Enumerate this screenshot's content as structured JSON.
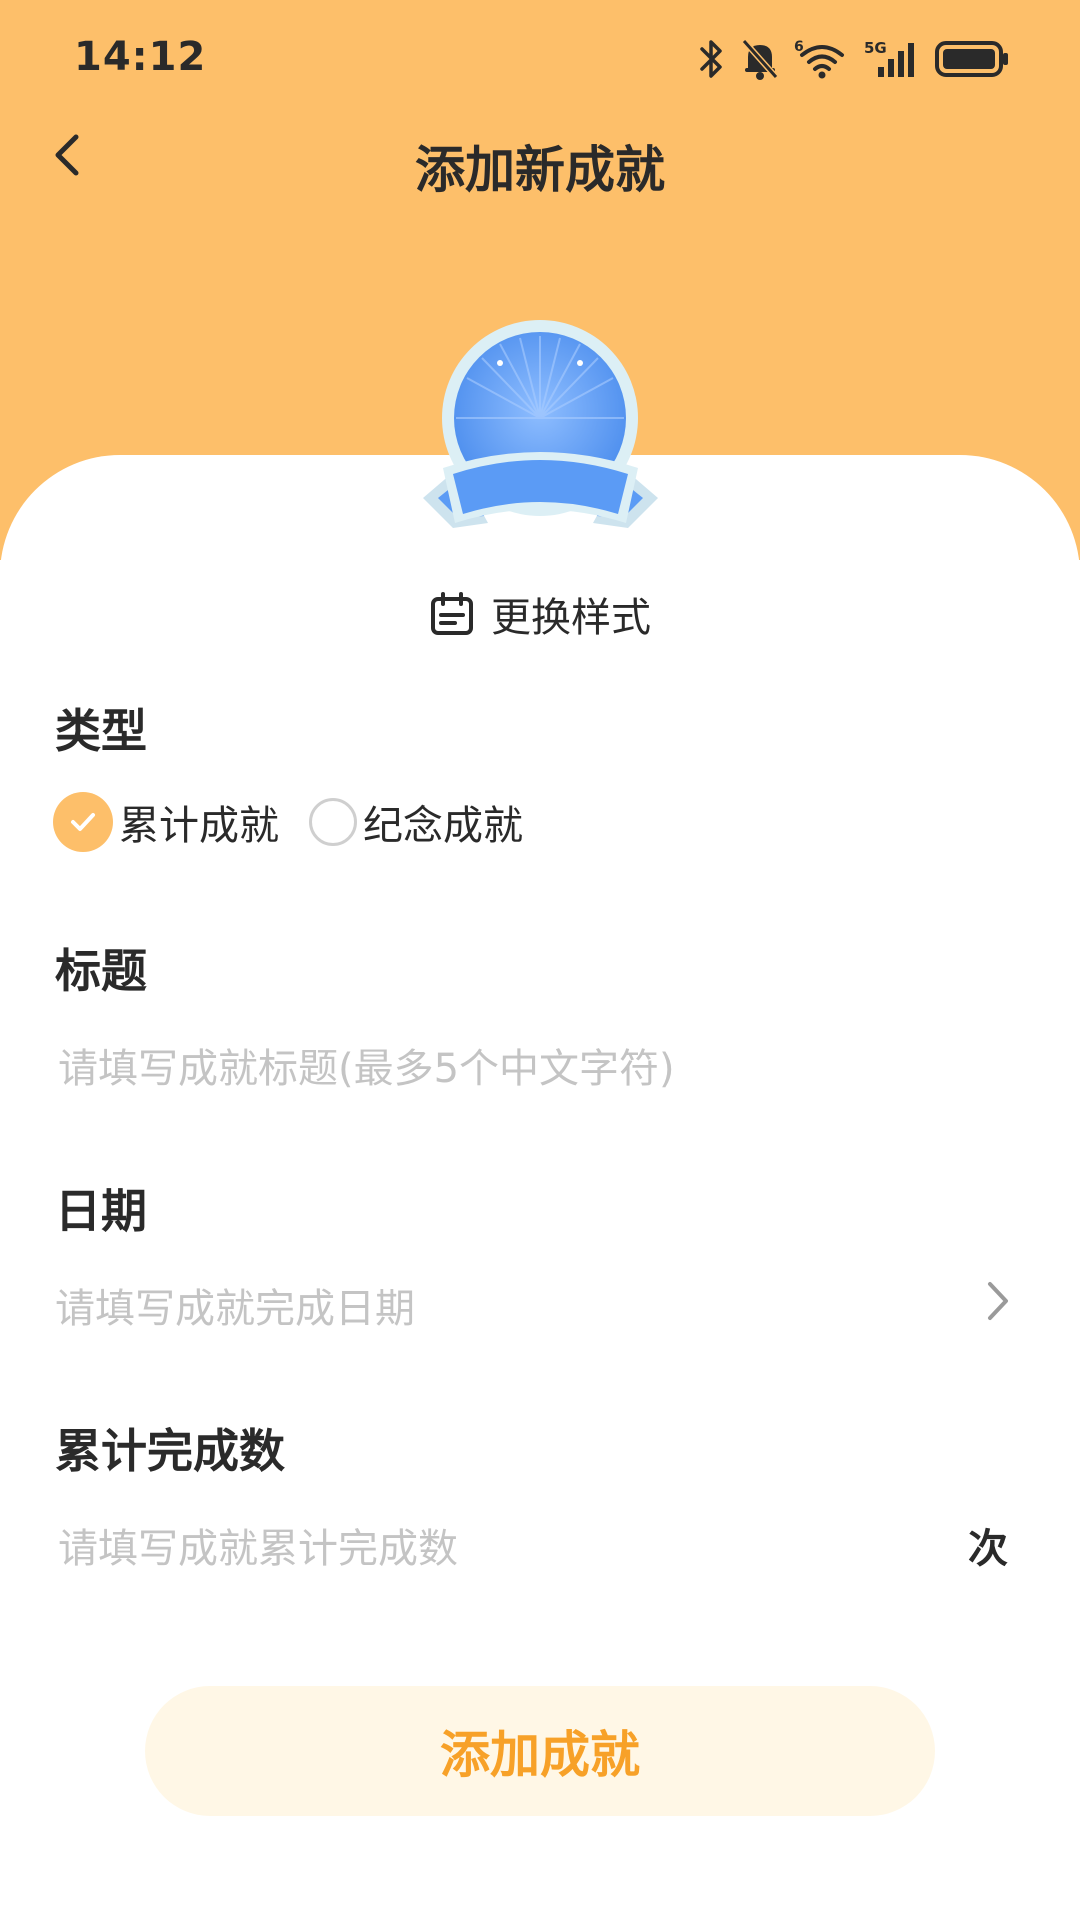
{
  "status_bar": {
    "time": "14:12",
    "icons": [
      "bluetooth-icon",
      "mute-bell-icon",
      "wifi-icon",
      "signal-5g-icon",
      "battery-icon"
    ],
    "network_label": "5G",
    "wifi_label": "6"
  },
  "header": {
    "title": "添加新成就"
  },
  "badge": {
    "style_button_label": "更换样式"
  },
  "type_section": {
    "label": "类型",
    "options": [
      {
        "label": "累计成就",
        "selected": true
      },
      {
        "label": "纪念成就",
        "selected": false
      }
    ]
  },
  "title_section": {
    "label": "标题",
    "placeholder": "请填写成就标题(最多5个中文字符)"
  },
  "date_section": {
    "label": "日期",
    "placeholder": "请填写成就完成日期"
  },
  "count_section": {
    "label": "累计完成数",
    "placeholder": "请填写成就累计完成数",
    "unit": "次"
  },
  "submit": {
    "label": "添加成就"
  },
  "colors": {
    "header_bg": "#FDBF6A",
    "accent": "#F7A128",
    "button_bg": "#FFF7E6",
    "badge_blue": "#5B9BF5"
  }
}
